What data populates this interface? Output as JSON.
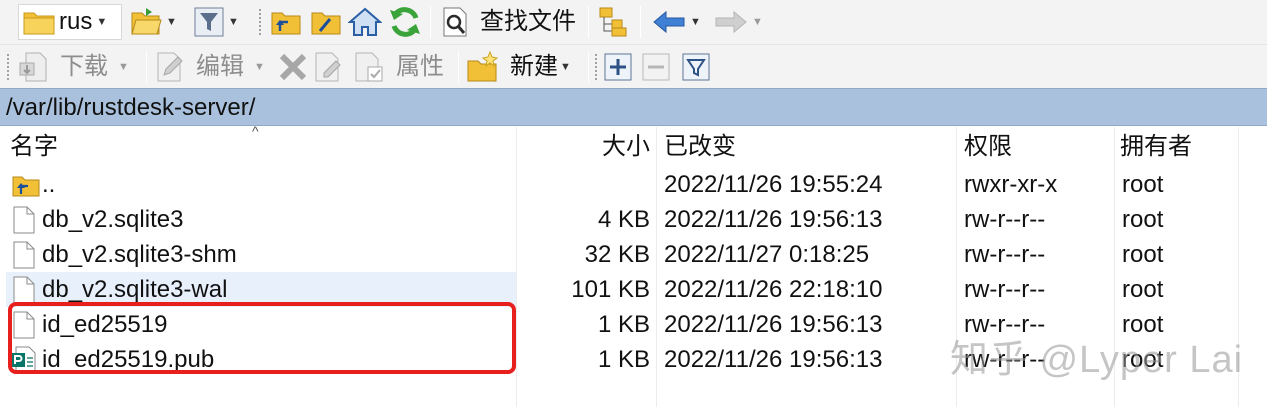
{
  "toolbar1": {
    "location_combo": "rus",
    "find_files_label": "查找文件"
  },
  "toolbar2": {
    "download_label": "下载",
    "edit_label": "编辑",
    "properties_label": "属性",
    "new_label": "新建"
  },
  "path": "/var/lib/rustdesk-server/",
  "columns": {
    "name": "名字",
    "size": "大小",
    "modified": "已改变",
    "permissions": "权限",
    "owner": "拥有者"
  },
  "files": [
    {
      "name": "..",
      "size": "",
      "modified": "2022/11/26 19:55:24",
      "permissions": "rwxr-xr-x",
      "owner": "root",
      "icon": "parent-folder-icon"
    },
    {
      "name": "db_v2.sqlite3",
      "size": "4 KB",
      "modified": "2022/11/26 19:56:13",
      "permissions": "rw-r--r--",
      "owner": "root",
      "icon": "file-icon"
    },
    {
      "name": "db_v2.sqlite3-shm",
      "size": "32 KB",
      "modified": "2022/11/27 0:18:25",
      "permissions": "rw-r--r--",
      "owner": "root",
      "icon": "file-icon"
    },
    {
      "name": "db_v2.sqlite3-wal",
      "size": "101 KB",
      "modified": "2022/11/26 22:18:10",
      "permissions": "rw-r--r--",
      "owner": "root",
      "icon": "file-icon"
    },
    {
      "name": "id_ed25519",
      "size": "1 KB",
      "modified": "2022/11/26 19:56:13",
      "permissions": "rw-r--r--",
      "owner": "root",
      "icon": "file-icon"
    },
    {
      "name": "id_ed25519.pub",
      "size": "1 KB",
      "modified": "2022/11/26 19:56:13",
      "permissions": "rw-r--r--",
      "owner": "root",
      "icon": "publisher-file-icon"
    }
  ],
  "watermark": "知乎 @Lyper Lai",
  "colors": {
    "pathbar": "#a9c1dc",
    "highlight": "#e8201d",
    "selected_row": "#e8f1fb"
  }
}
